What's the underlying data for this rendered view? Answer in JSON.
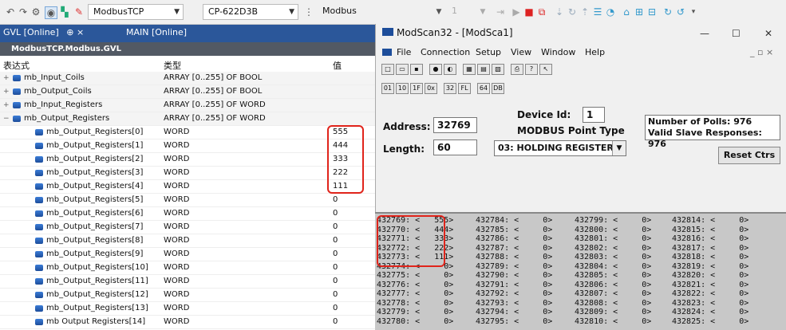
{
  "toolbar": {
    "project_combo": "ModbusTCP",
    "device_combo": "CP-622D3B",
    "protocol_combo": "Modbus",
    "num_combo": "1"
  },
  "left_panel": {
    "tab_gvl": "GVL [Online]",
    "tab_pin": "⊕ ×",
    "tab_main": "MAIN [Online]",
    "tree_title": "ModbusTCP.Modbus.GVL",
    "col_expr": "表达式",
    "col_type": "类型",
    "col_value": "值",
    "rows": [
      {
        "name": "mb_Input_Coils",
        "type": "ARRAY [0..255] OF BOOL",
        "value": "",
        "exp": "+",
        "indent": 0
      },
      {
        "name": "mb_Output_Coils",
        "type": "ARRAY [0..255] OF BOOL",
        "value": "",
        "exp": "+",
        "indent": 0
      },
      {
        "name": "mb_Input_Registers",
        "type": "ARRAY [0..255] OF WORD",
        "value": "",
        "exp": "+",
        "indent": 0
      },
      {
        "name": "mb_Output_Registers",
        "type": "ARRAY [0..255] OF WORD",
        "value": "",
        "exp": "−",
        "indent": 0
      },
      {
        "name": "mb_Output_Registers[0]",
        "type": "WORD",
        "value": "555",
        "exp": "",
        "indent": 1
      },
      {
        "name": "mb_Output_Registers[1]",
        "type": "WORD",
        "value": "444",
        "exp": "",
        "indent": 1
      },
      {
        "name": "mb_Output_Registers[2]",
        "type": "WORD",
        "value": "333",
        "exp": "",
        "indent": 1
      },
      {
        "name": "mb_Output_Registers[3]",
        "type": "WORD",
        "value": "222",
        "exp": "",
        "indent": 1
      },
      {
        "name": "mb_Output_Registers[4]",
        "type": "WORD",
        "value": "111",
        "exp": "",
        "indent": 1
      },
      {
        "name": "mb_Output_Registers[5]",
        "type": "WORD",
        "value": "0",
        "exp": "",
        "indent": 1
      },
      {
        "name": "mb_Output_Registers[6]",
        "type": "WORD",
        "value": "0",
        "exp": "",
        "indent": 1
      },
      {
        "name": "mb_Output_Registers[7]",
        "type": "WORD",
        "value": "0",
        "exp": "",
        "indent": 1
      },
      {
        "name": "mb_Output_Registers[8]",
        "type": "WORD",
        "value": "0",
        "exp": "",
        "indent": 1
      },
      {
        "name": "mb_Output_Registers[9]",
        "type": "WORD",
        "value": "0",
        "exp": "",
        "indent": 1
      },
      {
        "name": "mb_Output_Registers[10]",
        "type": "WORD",
        "value": "0",
        "exp": "",
        "indent": 1
      },
      {
        "name": "mb_Output_Registers[11]",
        "type": "WORD",
        "value": "0",
        "exp": "",
        "indent": 1
      },
      {
        "name": "mb_Output_Registers[12]",
        "type": "WORD",
        "value": "0",
        "exp": "",
        "indent": 1
      },
      {
        "name": "mb_Output_Registers[13]",
        "type": "WORD",
        "value": "0",
        "exp": "",
        "indent": 1
      },
      {
        "name": "mb Output Registers[14]",
        "type": "WORD",
        "value": "0",
        "exp": "",
        "indent": 1
      }
    ]
  },
  "modscan": {
    "title": "ModScan32 - [ModSca1]",
    "win_min": "—",
    "win_max": "☐",
    "win_close": "✕",
    "menu": [
      "File",
      "Connection",
      "Setup",
      "View",
      "Window",
      "Help"
    ],
    "menu_right": "_ ▫ ×",
    "address_label": "Address:",
    "address_value": "32769",
    "length_label": "Length:",
    "length_value": "60",
    "device_id_label": "Device Id:",
    "device_id_value": "1",
    "point_type_label": "MODBUS Point Type",
    "point_type_value": "03: HOLDING REGISTER",
    "polls_line1": "Number of Polls: 976",
    "polls_line2": "Valid Slave Responses: 976",
    "reset_label": "Reset Ctrs",
    "registers": [
      [
        "432769: <   555>",
        "432770: <   444>",
        "432771: <   333>",
        "432772: <   222>",
        "432773: <   111>",
        "432774: <     0>",
        "432775: <     0>",
        "432776: <     0>",
        "432777: <     0>",
        "432778: <     0>",
        "432779: <     0>",
        "432780: <     0>"
      ],
      [
        "432784: <     0>",
        "432785: <     0>",
        "432786: <     0>",
        "432787: <     0>",
        "432788: <     0>",
        "432789: <     0>",
        "432790: <     0>",
        "432791: <     0>",
        "432792: <     0>",
        "432793: <     0>",
        "432794: <     0>",
        "432795: <     0>"
      ],
      [
        "432799: <     0>",
        "432800: <     0>",
        "432801: <     0>",
        "432802: <     0>",
        "432803: <     0>",
        "432804: <     0>",
        "432805: <     0>",
        "432806: <     0>",
        "432807: <     0>",
        "432808: <     0>",
        "432809: <     0>",
        "432810: <     0>"
      ],
      [
        "432814: <     0>",
        "432815: <     0>",
        "432816: <     0>",
        "432817: <     0>",
        "432818: <     0>",
        "432819: <     0>",
        "432820: <     0>",
        "432821: <     0>",
        "432822: <     0>",
        "432823: <     0>",
        "432824: <     0>",
        "432825: <     0>"
      ]
    ]
  },
  "colors": {
    "tab_bar": "#2b579a",
    "highlight": "#e0241b",
    "grid_bg": "#c8c8c8"
  }
}
